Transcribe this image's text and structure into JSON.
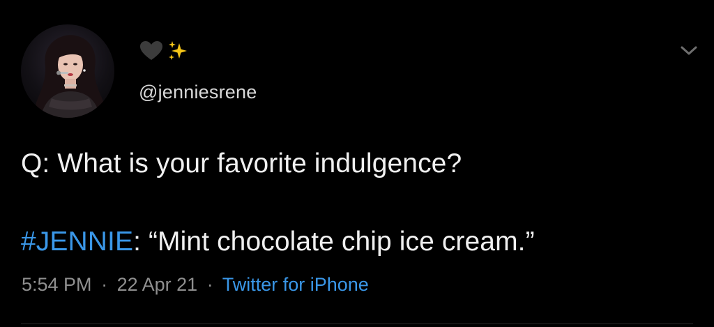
{
  "user": {
    "display_name_icons": [
      "black-heart-icon",
      "sparkles-icon"
    ],
    "handle": "@jenniesrene"
  },
  "tweet": {
    "question": "Q: What is your favorite indulgence?",
    "hashtag": "#JENNIE",
    "answer": ": “Mint chocolate chip ice cream.”"
  },
  "meta": {
    "time": "5:54 PM",
    "separator": "·",
    "date": "22 Apr 21",
    "source": "Twitter for iPhone"
  },
  "colors": {
    "background": "#000000",
    "text": "#f0f0f0",
    "muted": "#8f8f8f",
    "link": "#3a97e8",
    "heart": "#3c3c3c",
    "sparkles": "#f5c518"
  }
}
